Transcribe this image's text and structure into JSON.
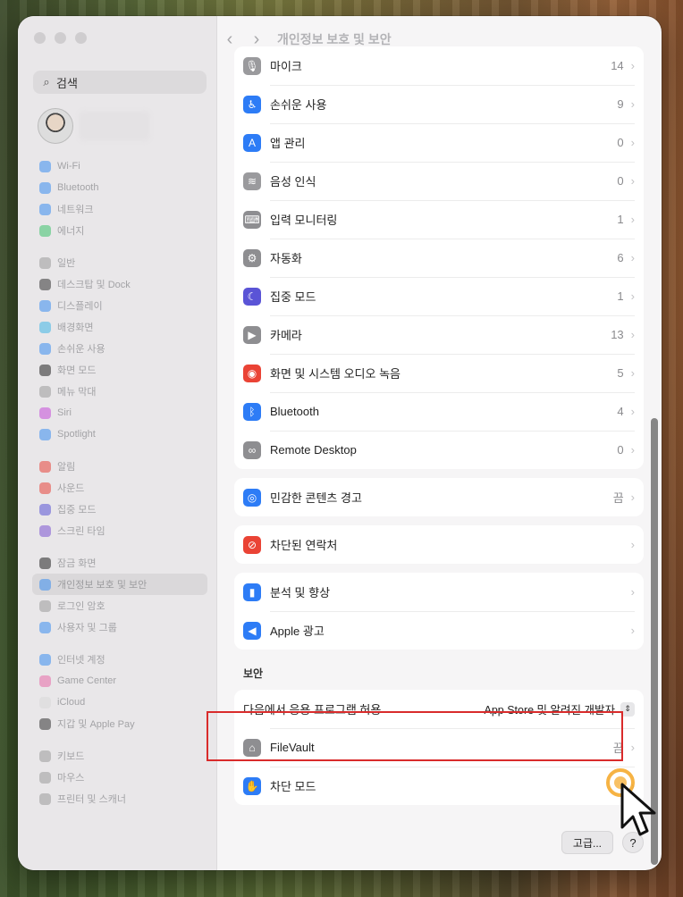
{
  "window": {
    "title": "개인정보 보호 및 보안"
  },
  "sidebar": {
    "search_placeholder": "검색",
    "groups": [
      [
        {
          "label": "Wi-Fi",
          "icon": "wifi-icon",
          "color": "#3b8ef0"
        },
        {
          "label": "Bluetooth",
          "icon": "bluetooth-icon",
          "color": "#3b8ef0"
        },
        {
          "label": "네트워크",
          "icon": "globe-icon",
          "color": "#3b8ef0"
        },
        {
          "label": "에너지",
          "icon": "bolt-icon",
          "color": "#3cc36b"
        }
      ],
      [
        {
          "label": "일반",
          "icon": "gear-icon",
          "color": "#9a9a9a"
        },
        {
          "label": "데스크탑 및 Dock",
          "icon": "dock-icon",
          "color": "#333333"
        },
        {
          "label": "디스플레이",
          "icon": "sun-icon",
          "color": "#3b8ef0"
        },
        {
          "label": "배경화면",
          "icon": "wallpaper-icon",
          "color": "#3fb6e6"
        },
        {
          "label": "손쉬운 사용",
          "icon": "accessibility-icon",
          "color": "#3b8ef0"
        },
        {
          "label": "화면 모드",
          "icon": "appearance-icon",
          "color": "#222222"
        },
        {
          "label": "메뉴 막대",
          "icon": "menubar-icon",
          "color": "#9a9a9a"
        },
        {
          "label": "Siri",
          "icon": "siri-icon",
          "color": "#c44ad8"
        },
        {
          "label": "Spotlight",
          "icon": "spotlight-icon",
          "color": "#3b8ef0"
        }
      ],
      [
        {
          "label": "알림",
          "icon": "bell-icon",
          "color": "#e8443a"
        },
        {
          "label": "사운드",
          "icon": "speaker-icon",
          "color": "#e8443a"
        },
        {
          "label": "집중 모드",
          "icon": "moon-icon",
          "color": "#5a54d6"
        },
        {
          "label": "스크린 타임",
          "icon": "hourglass-icon",
          "color": "#7b53d1"
        }
      ],
      [
        {
          "label": "잠금 화면",
          "icon": "lock-screen-icon",
          "color": "#222222"
        },
        {
          "label": "개인정보 보호 및 보안",
          "icon": "hand-icon",
          "color": "#3b8ef0",
          "active": true
        },
        {
          "label": "로그인 암호",
          "icon": "lock-icon",
          "color": "#9a9a9a"
        },
        {
          "label": "사용자 및 그룹",
          "icon": "users-icon",
          "color": "#3b8ef0"
        }
      ],
      [
        {
          "label": "인터넷 계정",
          "icon": "at-icon",
          "color": "#3b8ef0"
        },
        {
          "label": "Game Center",
          "icon": "game-center-icon",
          "color": "#e86aa8"
        },
        {
          "label": "iCloud",
          "icon": "cloud-icon",
          "color": "#d8d8d8"
        },
        {
          "label": "지갑 및 Apple Pay",
          "icon": "wallet-icon",
          "color": "#333333"
        }
      ],
      [
        {
          "label": "키보드",
          "icon": "keyboard-icon",
          "color": "#9a9a9a"
        },
        {
          "label": "마우스",
          "icon": "mouse-icon",
          "color": "#9a9a9a"
        },
        {
          "label": "프린터 및 스캐너",
          "icon": "printer-icon",
          "color": "#9a9a9a"
        }
      ]
    ]
  },
  "main": {
    "privacy_rows": [
      {
        "label": "마이크",
        "value": "14",
        "icon": "microphone-icon",
        "color": "#9a9a9d",
        "glyph": "🎙"
      },
      {
        "label": "손쉬운 사용",
        "value": "9",
        "icon": "accessibility-icon",
        "color": "#2d7cf6",
        "glyph": "♿"
      },
      {
        "label": "앱 관리",
        "value": "0",
        "icon": "app-store-icon",
        "color": "#2d7cf6",
        "glyph": "A"
      },
      {
        "label": "음성 인식",
        "value": "0",
        "icon": "waveform-icon",
        "color": "#9a9a9d",
        "glyph": "≋"
      },
      {
        "label": "입력 모니터링",
        "value": "1",
        "icon": "keyboard-icon",
        "color": "#8e8e91",
        "glyph": "⌨"
      },
      {
        "label": "자동화",
        "value": "6",
        "icon": "gears-icon",
        "color": "#8e8e91",
        "glyph": "⚙"
      },
      {
        "label": "집중 모드",
        "value": "1",
        "icon": "moon-icon",
        "color": "#5a54d6",
        "glyph": "☾"
      },
      {
        "label": "카메라",
        "value": "13",
        "icon": "camera-icon",
        "color": "#8e8e91",
        "glyph": "▶"
      },
      {
        "label": "화면 및 시스템 오디오 녹음",
        "value": "5",
        "icon": "record-icon",
        "color": "#ea4335",
        "glyph": "◉"
      },
      {
        "label": "Bluetooth",
        "value": "4",
        "icon": "bluetooth-icon",
        "color": "#2d7cf6",
        "glyph": "ᛒ"
      },
      {
        "label": "Remote Desktop",
        "value": "0",
        "icon": "binoculars-icon",
        "color": "#8e8e91",
        "glyph": "∞"
      }
    ],
    "sensitive_row": {
      "label": "민감한 콘텐츠 경고",
      "value": "끔",
      "icon": "eye-icon",
      "color": "#2d7cf6",
      "glyph": "◎"
    },
    "blocked_row": {
      "label": "차단된 연락처",
      "icon": "blocked-icon",
      "color": "#ea4335",
      "glyph": "⊘"
    },
    "analytics_rows": [
      {
        "label": "분석 및 향상",
        "icon": "chart-icon",
        "color": "#2d7cf6",
        "glyph": "▮"
      },
      {
        "label": "Apple 광고",
        "icon": "megaphone-icon",
        "color": "#2d7cf6",
        "glyph": "◀"
      }
    ],
    "security": {
      "title": "보안",
      "allow_label": "다음에서 응용 프로그램 허용",
      "allow_value": "App Store 및 알려진 개발자",
      "filevault": {
        "label": "FileVault",
        "value": "끔",
        "icon": "filevault-icon",
        "color": "#8e8e91",
        "glyph": "⌂"
      },
      "lockdown": {
        "label": "차단 모드",
        "icon": "raised-hand-icon",
        "color": "#2d7cf6",
        "glyph": "✋"
      }
    },
    "advanced_button": "고급...",
    "help_button": "?"
  }
}
